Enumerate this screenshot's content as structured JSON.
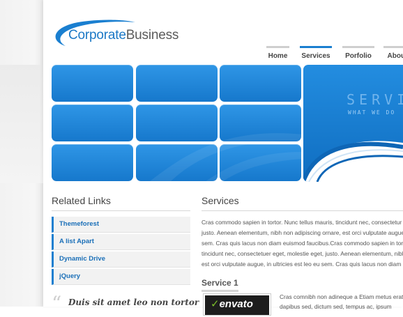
{
  "logo": {
    "word1": "Corporate",
    "word2": "Business"
  },
  "nav": {
    "items": [
      {
        "label": "Home",
        "active": false
      },
      {
        "label": "Services",
        "active": true
      },
      {
        "label": "Porfolio",
        "active": false
      },
      {
        "label": "About",
        "active": false
      }
    ]
  },
  "hero": {
    "title": "SERVICES",
    "subtitle": "WHAT WE DO"
  },
  "sidebar": {
    "heading": "Related Links",
    "links": [
      "Themeforest",
      "A list Apart",
      "Dynamic Drive",
      "jQuery"
    ],
    "quote": "Duis sit amet leo non tortor"
  },
  "main": {
    "heading": "Services",
    "paragraph_lines": [
      "Cras commodo sapien in tortor. Nunc tellus mauris, tincidunt nec, consectetur",
      "justo. Aenean elementum, nibh non adipiscing ornare, est orci vulputate augue",
      "sem. Cras quis lacus non diam euismod faucibus.Cras commodo sapien in tortor",
      "tincidunt nec, consectetuer eget, molestie eget, justo. Aenean elementum, nibh",
      "est orci vulputate augue, in ultricies est leo eu sem. Cras quis lacus non diam"
    ],
    "service1": {
      "heading": "Service 1",
      "thumb_label": "envato",
      "text_lines": [
        "Cras comnibh non adineque a Etiam metus erat",
        "dapibus sed, dictum sed, tempus ac, ipsum"
      ]
    }
  },
  "colors": {
    "accent": "#1a7fd0",
    "tile": "#1e84d6",
    "text": "#555555"
  }
}
